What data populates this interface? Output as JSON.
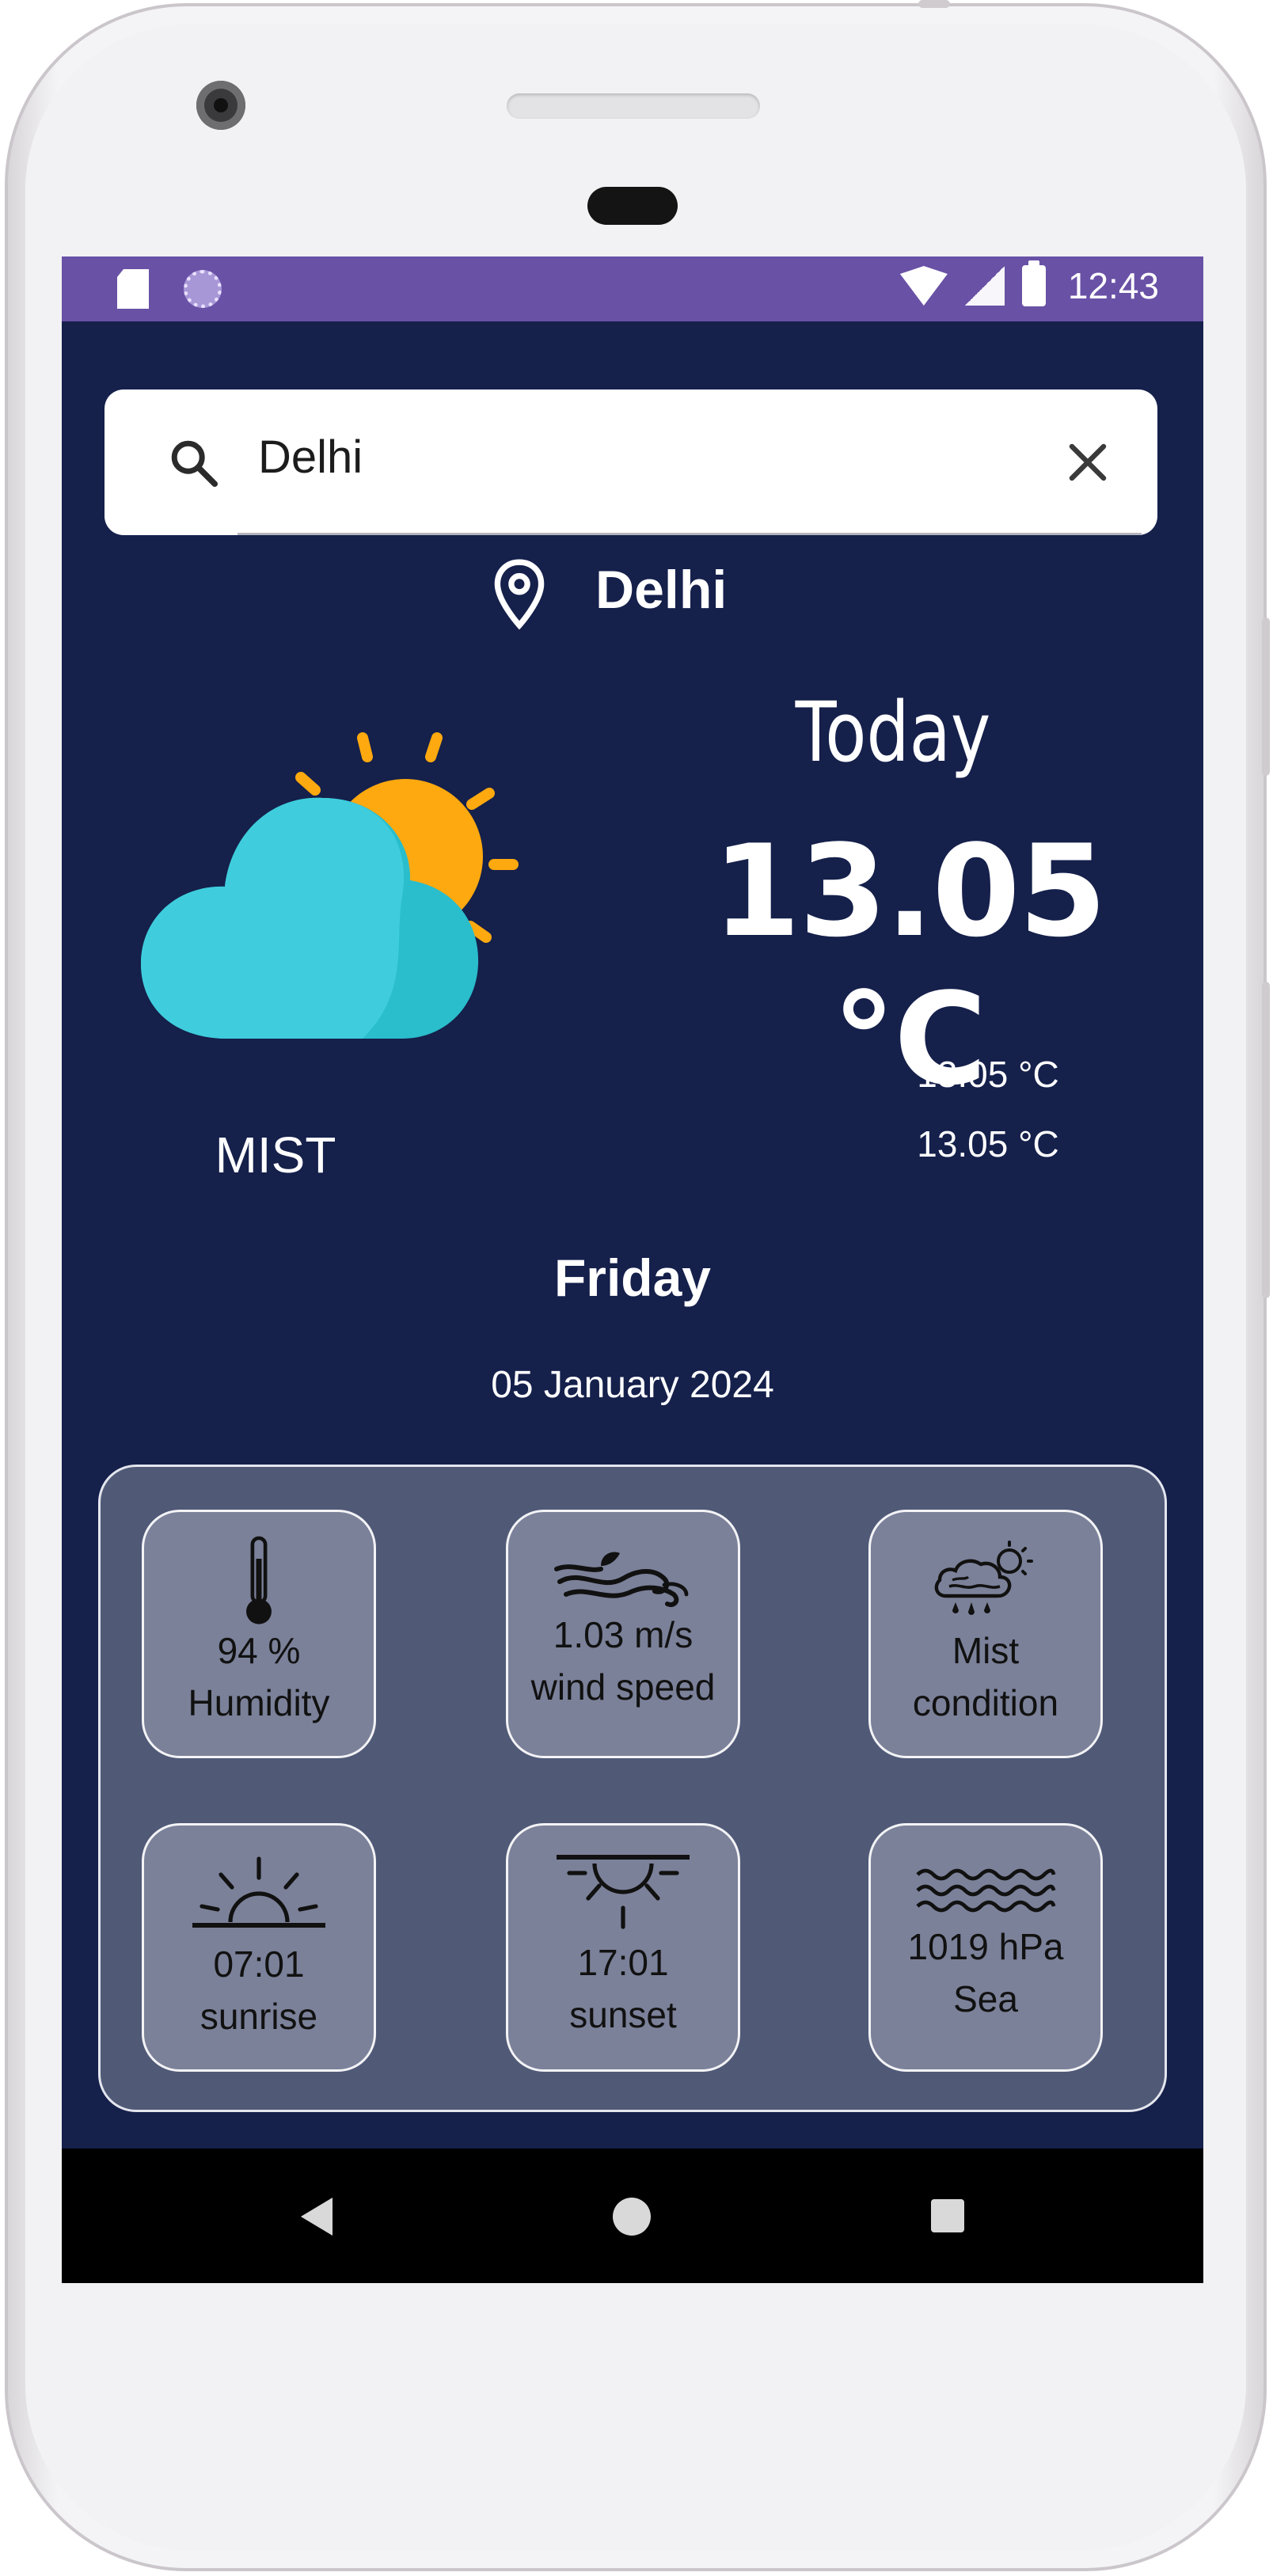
{
  "status_bar": {
    "time": "12:43"
  },
  "search": {
    "value": "Delhi"
  },
  "location": {
    "name": "Delhi"
  },
  "weather": {
    "today_label": "Today",
    "temperature": "13.05 °C",
    "temp_line_1": "13.05 °C",
    "temp_line_2": "13.05 °C",
    "condition": "MIST",
    "day": "Friday",
    "date": "05 January 2024"
  },
  "stats": [
    {
      "icon": "thermometer-icon",
      "value": "94 %",
      "label": "Humidity"
    },
    {
      "icon": "wind-icon",
      "value": "1.03 m/s",
      "label": "wind speed"
    },
    {
      "icon": "cloud-rain-sun-icon",
      "value": "Mist",
      "label": "condition"
    },
    {
      "icon": "sunrise-icon",
      "value": "07:01",
      "label": "sunrise"
    },
    {
      "icon": "sunset-icon",
      "value": "17:01",
      "label": "sunset"
    },
    {
      "icon": "waves-icon",
      "value": "1019 hPa",
      "label": "Sea"
    }
  ],
  "colors": {
    "status_bar": "#6951a6",
    "background": "#15204b",
    "panel": "#505a77",
    "card": "#7b8199",
    "cloud": "#3fc9dc",
    "sun": "#fda90f"
  }
}
